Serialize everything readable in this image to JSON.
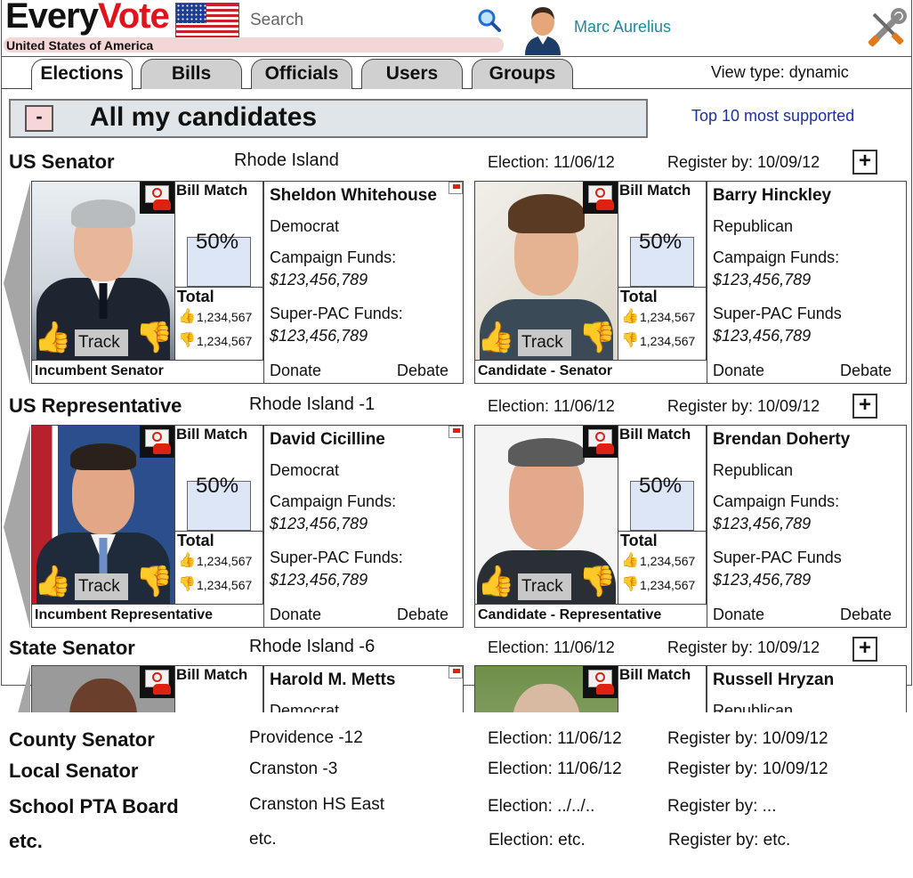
{
  "header": {
    "logo_every": "Every",
    "logo_vote": "Vote",
    "country": "United States of America",
    "search_placeholder": "Search",
    "username": "Marc Aurelius"
  },
  "tabs": [
    {
      "label": "Elections",
      "active": true
    },
    {
      "label": "Bills",
      "active": false
    },
    {
      "label": "Officials",
      "active": false
    },
    {
      "label": "Users",
      "active": false
    },
    {
      "label": "Groups",
      "active": false
    }
  ],
  "view_type": "View type: dynamic",
  "section": {
    "collapse_label": "-",
    "title": "All my candidates",
    "top_link": "Top 10 most supported"
  },
  "offices": [
    {
      "office": "US Senator",
      "district": "Rhode Island",
      "election": "Election: 11/06/12",
      "register": "Register by: 10/09/12",
      "expand_label": "+",
      "cards": [
        {
          "name": "Sheldon Whitehouse",
          "party": "Democrat",
          "caption": "Incumbent Senator",
          "bill_match_label": "Bill Match",
          "bill_match": "50%",
          "total_label": "Total",
          "up_count": "1,234,567",
          "down_count": "1,234,567",
          "track_label": "Track",
          "campaign_label": "Campaign Funds:",
          "campaign_value": "$123,456,789",
          "superpac_label": "Super-PAC Funds:",
          "superpac_value": "$123,456,789",
          "donate_label": "Donate",
          "debate_label": "Debate"
        },
        {
          "name": "Barry Hinckley",
          "party": "Republican",
          "caption": "Candidate - Senator",
          "bill_match_label": "Bill Match",
          "bill_match": "50%",
          "total_label": "Total",
          "up_count": "1,234,567",
          "down_count": "1,234,567",
          "track_label": "Track",
          "campaign_label": "Campaign Funds:",
          "campaign_value": "$123,456,789",
          "superpac_label": "Super-PAC Funds",
          "superpac_value": "$123,456,789",
          "donate_label": "Donate",
          "debate_label": "Debate"
        }
      ]
    },
    {
      "office": "US Representative",
      "district": "Rhode Island -1",
      "election": "Election: 11/06/12",
      "register": "Register by: 10/09/12",
      "expand_label": "+",
      "cards": [
        {
          "name": "David Cicilline",
          "party": "Democrat",
          "caption": "Incumbent Representative",
          "bill_match_label": "Bill Match",
          "bill_match": "50%",
          "total_label": "Total",
          "up_count": "1,234,567",
          "down_count": "1,234,567",
          "track_label": "Track",
          "campaign_label": "Campaign Funds:",
          "campaign_value": "$123,456,789",
          "superpac_label": "Super-PAC Funds:",
          "superpac_value": "$123,456,789",
          "donate_label": "Donate",
          "debate_label": "Debate"
        },
        {
          "name": "Brendan Doherty",
          "party": "Republican",
          "caption": "Candidate - Representative",
          "bill_match_label": "Bill Match",
          "bill_match": "50%",
          "total_label": "Total",
          "up_count": "1,234,567",
          "down_count": "1,234,567",
          "track_label": "Track",
          "campaign_label": "Campaign Funds:",
          "campaign_value": "$123,456,789",
          "superpac_label": "Super-PAC Funds",
          "superpac_value": "$123,456,789",
          "donate_label": "Donate",
          "debate_label": "Debate"
        }
      ]
    },
    {
      "office": "State Senator",
      "district": "Rhode Island -6",
      "election": "Election: 11/06/12",
      "register": "Register by: 10/09/12",
      "expand_label": "+",
      "cards": [
        {
          "name": "Harold M. Metts",
          "party": "Democrat",
          "bill_match_label": "Bill Match"
        },
        {
          "name": "Russell Hryzan",
          "party": "Republican",
          "bill_match_label": "Bill Match"
        }
      ]
    }
  ],
  "other_offices": [
    {
      "office": "County Senator",
      "district": "Providence -12",
      "election": "Election: 11/06/12",
      "register": "Register by: 10/09/12"
    },
    {
      "office": "Local Senator",
      "district": "Cranston -3",
      "election": "Election: 11/06/12",
      "register": "Register by: 10/09/12"
    },
    {
      "office": "School PTA Board",
      "district": "Cranston HS East",
      "election": "Election: ../../..",
      "register": "Register by: ..."
    },
    {
      "office": "etc.",
      "district": "etc.",
      "election": "Election: etc.",
      "register": "Register by: etc."
    }
  ],
  "colors": {
    "brand_red": "#e0141a",
    "thumb_up": "#2eae3a",
    "thumb_down": "#e0141a",
    "link": "#1a2fa8",
    "username": "#1a8aa0"
  },
  "icons": [
    "us-flag-icon",
    "search-icon",
    "user-avatar-icon",
    "tools-icon",
    "contact-icon",
    "thumbs-up-icon",
    "thumbs-down-icon",
    "report-flag-icon",
    "chevron-left-icon",
    "chevron-right-icon"
  ]
}
